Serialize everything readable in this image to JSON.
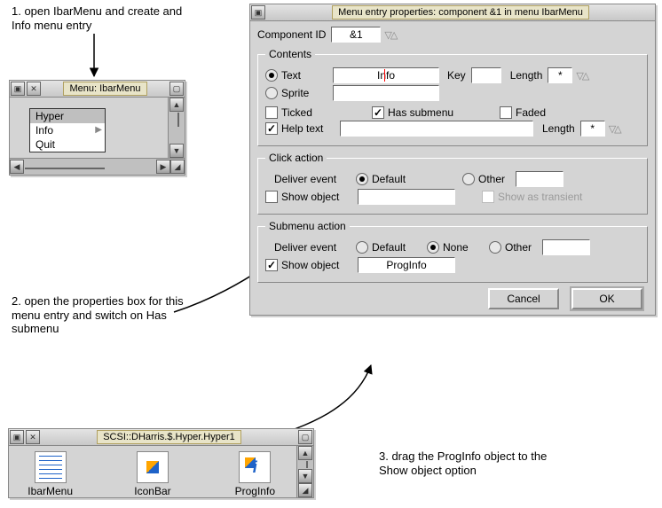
{
  "annotations": {
    "step1": "1. open IbarMenu and create and Info menu entry",
    "step2": "2. open the properties box for this menu entry and switch on Has submenu",
    "step3": "3. drag the ProgInfo object to the Show object option"
  },
  "menu_window": {
    "title": "Menu: IbarMenu",
    "items": [
      "Hyper",
      "Info",
      "Quit"
    ],
    "selected_index": 0,
    "submenu_index": 1
  },
  "props_window": {
    "title": "Menu entry properties: component &1 in menu IbarMenu",
    "component_id_label": "Component ID",
    "component_id_value": "&1",
    "contents": {
      "legend": "Contents",
      "text_label": "Text",
      "text_value": "Info",
      "key_label": "Key",
      "key_value": "",
      "length_label": "Length",
      "length_value": "*",
      "sprite_label": "Sprite",
      "sprite_value": "",
      "ticked_label": "Ticked",
      "has_submenu_label": "Has submenu",
      "faded_label": "Faded",
      "help_text_label": "Help text",
      "help_text_value": "",
      "help_length_label": "Length",
      "help_length_value": "*"
    },
    "click_action": {
      "legend": "Click action",
      "deliver_event_label": "Deliver event",
      "default_label": "Default",
      "other_label": "Other",
      "other_value": "",
      "show_object_label": "Show object",
      "show_object_value": "",
      "show_as_transient_label": "Show as transient"
    },
    "submenu_action": {
      "legend": "Submenu action",
      "deliver_event_label": "Deliver event",
      "default_label": "Default",
      "none_label": "None",
      "other_label": "Other",
      "other_value": "",
      "show_object_label": "Show object",
      "show_object_value": "ProgInfo"
    },
    "buttons": {
      "cancel": "Cancel",
      "ok": "OK"
    }
  },
  "filer_window": {
    "title": "SCSI::DHarris.$.Hyper.Hyper1",
    "files": [
      "IbarMenu",
      "IconBar",
      "ProgInfo"
    ]
  }
}
